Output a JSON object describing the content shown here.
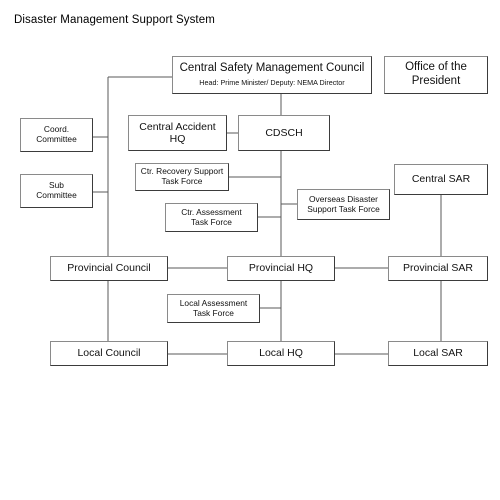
{
  "page": {
    "title": "Disaster Management Support System",
    "background_color": "#ffffff",
    "box_border_color": "#3b3b3b",
    "line_color": "#5a5a5a"
  },
  "chart_data": {
    "type": "diagram",
    "title": "Disaster Management Support System",
    "diagram_kind": "organizational-hierarchy-chart"
  },
  "nodes": {
    "central_council": {
      "label": "Central Safety Management Council",
      "subtitle": "Head: Prime Minister/ Deputy: NEMA Director"
    },
    "office_president": {
      "label": "Office of the\nPresident"
    },
    "coord_committee": {
      "label": "Coord.\nCommittee"
    },
    "sub_committee": {
      "label": "Sub\nCommittee"
    },
    "central_accident_hq": {
      "label": "Central Accident\nHQ"
    },
    "cdsch": {
      "label": "CDSCH"
    },
    "ctr_recovery_tf": {
      "label": "Ctr. Recovery Support\nTask Force"
    },
    "ctr_assessment_tf": {
      "label": "Ctr. Assessment\nTask Force"
    },
    "overseas_disaster_tf": {
      "label": "Overseas Disaster\nSupport Task Force"
    },
    "central_sar": {
      "label": "Central SAR"
    },
    "provincial_council": {
      "label": "Provincial Council"
    },
    "provincial_hq": {
      "label": "Provincial HQ"
    },
    "provincial_sar": {
      "label": "Provincial SAR"
    },
    "local_assessment_tf": {
      "label": "Local Assessment\nTask Force"
    },
    "local_council": {
      "label": "Local Council"
    },
    "local_hq": {
      "label": "Local HQ"
    },
    "local_sar": {
      "label": "Local SAR"
    }
  },
  "connections": [
    {
      "from": "central_council",
      "to": "coord_committee"
    },
    {
      "from": "central_council",
      "to": "sub_committee"
    },
    {
      "from": "central_council",
      "to": "provincial_council"
    },
    {
      "from": "central_council",
      "to": "cdsch"
    },
    {
      "from": "cdsch",
      "to": "central_accident_hq"
    },
    {
      "from": "cdsch",
      "to": "ctr_recovery_tf"
    },
    {
      "from": "cdsch",
      "to": "ctr_assessment_tf"
    },
    {
      "from": "cdsch",
      "to": "overseas_disaster_tf"
    },
    {
      "from": "cdsch",
      "to": "provincial_hq"
    },
    {
      "from": "central_sar",
      "to": "provincial_sar"
    },
    {
      "from": "provincial_council",
      "to": "provincial_hq"
    },
    {
      "from": "provincial_hq",
      "to": "provincial_sar"
    },
    {
      "from": "provincial_council",
      "to": "local_council"
    },
    {
      "from": "provincial_hq",
      "to": "local_assessment_tf"
    },
    {
      "from": "provincial_hq",
      "to": "local_hq"
    },
    {
      "from": "provincial_sar",
      "to": "local_sar"
    },
    {
      "from": "local_council",
      "to": "local_hq"
    },
    {
      "from": "local_hq",
      "to": "local_sar"
    }
  ]
}
